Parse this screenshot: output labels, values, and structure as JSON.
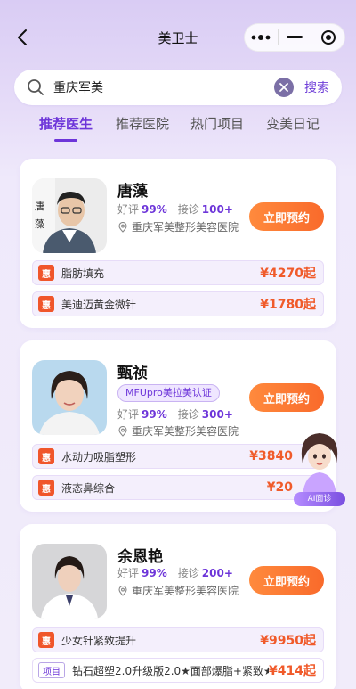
{
  "header": {
    "title": "美卫士"
  },
  "search": {
    "value": "重庆军美",
    "button_label": "搜索"
  },
  "tabs": [
    {
      "label": "推荐医生",
      "active": true
    },
    {
      "label": "推荐医院",
      "active": false
    },
    {
      "label": "热门项目",
      "active": false
    },
    {
      "label": "变美日记",
      "active": false
    }
  ],
  "labels": {
    "rating": "好评",
    "visits": "接诊",
    "book": "立即预约",
    "discount_badge": "惠",
    "project_badge": "项目"
  },
  "doctors": [
    {
      "name": "唐藻",
      "portrait_text": "唐 藻",
      "rating": "99%",
      "visits": "100+",
      "hospital": "重庆军美整形美容医院",
      "services": [
        {
          "tag": "惠",
          "name": "脂肪填充",
          "price": "¥4270起"
        },
        {
          "tag": "惠",
          "name": "美迪迈黄金微针",
          "price": "¥1780起"
        }
      ]
    },
    {
      "name": "甄祯",
      "cert": "MFUpro美拉美认证",
      "rating": "99%",
      "visits": "300+",
      "hospital": "重庆军美整形美容医院",
      "services": [
        {
          "tag": "惠",
          "name": "水动力吸脂塑形",
          "price": "¥3840"
        },
        {
          "tag": "惠",
          "name": "液态鼻综合",
          "price": "¥20"
        }
      ]
    },
    {
      "name": "余恩艳",
      "rating": "99%",
      "visits": "200+",
      "hospital": "重庆军美整形美容医院",
      "services": [
        {
          "tag": "惠",
          "name": "少女针紧致提升",
          "price": "¥9950起"
        },
        {
          "tag": "项目",
          "name": "钻石超塑2.0升级版2.0★面部爆脂+紧致★熳...",
          "price": "¥414起"
        }
      ]
    }
  ],
  "ai_widget": {
    "label": "AI面诊"
  },
  "colors": {
    "accent": "#6d35d9",
    "button": "#f96a2b",
    "price": "#f05a2a"
  }
}
